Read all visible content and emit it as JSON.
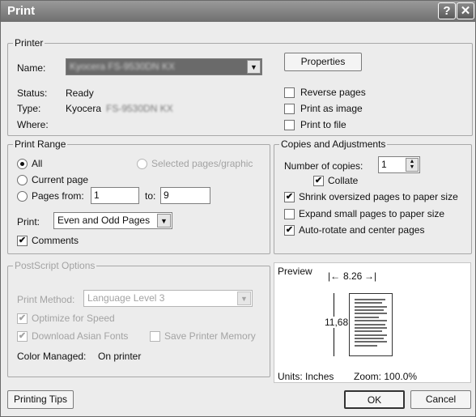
{
  "titlebar": {
    "title": "Print",
    "help_glyph": "?",
    "close_glyph": "✕"
  },
  "printer": {
    "legend": "Printer",
    "name_label": "Name:",
    "name_value": "Kyocera FS-9530DN KX",
    "properties_label": "Properties",
    "status_label": "Status:",
    "status_value": "Ready",
    "type_label": "Type:",
    "type_value": "Kyocera",
    "type_value_blurred": "FS-9530DN KX",
    "where_label": "Where:",
    "reverse_pages": {
      "label": "Reverse pages",
      "checked": false
    },
    "print_as_image": {
      "label": "Print as image",
      "checked": false
    },
    "print_to_file": {
      "label": "Print to file",
      "checked": false
    }
  },
  "range": {
    "legend": "Print Range",
    "all": "All",
    "selected": "Selected pages/graphic",
    "current": "Current page",
    "pages_from": "Pages from:",
    "from_value": "1",
    "to_label": "to:",
    "to_value": "9",
    "print_label": "Print:",
    "print_option": "Even and Odd Pages",
    "comments": "Comments"
  },
  "copies": {
    "legend": "Copies and Adjustments",
    "number_label": "Number of copies:",
    "number_value": "1",
    "collate": "Collate",
    "shrink": "Shrink oversized pages to paper size",
    "expand": "Expand small pages to paper size",
    "autorotate": "Auto-rotate and center pages"
  },
  "postscript": {
    "legend": "PostScript Options",
    "method_label": "Print Method:",
    "method_value": "Language Level 3",
    "optimize": "Optimize for Speed",
    "download_fonts": "Download Asian Fonts",
    "save_memory": "Save Printer Memory",
    "color_label": "Color Managed:",
    "color_value": "On printer"
  },
  "preview": {
    "label": "Preview",
    "width": "8.26",
    "height": "11,68",
    "units": "Units: Inches",
    "zoom": "Zoom: 100.0%"
  },
  "footer": {
    "tips": "Printing Tips",
    "ok": "OK",
    "cancel": "Cancel"
  },
  "colors": {
    "titlebar": "#7d7d7d",
    "dialog_bg": "#ececec",
    "disabled": "#a3a3a3"
  }
}
